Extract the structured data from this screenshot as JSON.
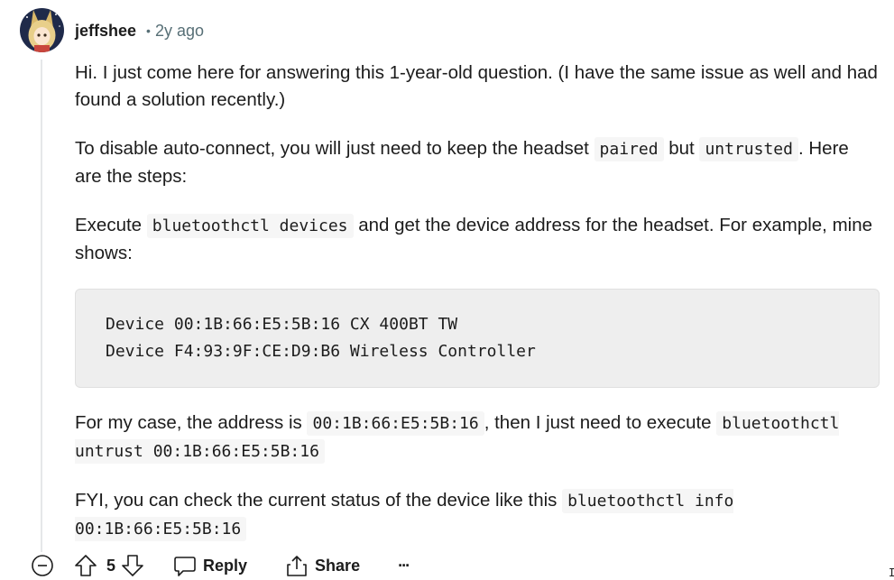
{
  "comment": {
    "author": "jeffshee",
    "separator": "•",
    "age": "2y ago",
    "paragraphs": {
      "p1": "Hi. I just come here for answering this 1-year-old question. (I have the same issue as well and had found a solution recently.)",
      "p2_a": "To disable auto-connect, you will just need to keep the headset ",
      "p2_code1": "paired",
      "p2_b": " but ",
      "p2_code2": "untrusted",
      "p2_c": ". Here are the steps:",
      "p3_a": "Execute ",
      "p3_code": "bluetoothctl devices",
      "p3_b": " and get the device address for the headset. For example, mine shows:",
      "code_block": [
        "Device 00:1B:66:E5:5B:16 CX 400BT TW",
        "Device F4:93:9F:CE:D9:B6 Wireless Controller"
      ],
      "p4_a": "For my case, the address is ",
      "p4_code1": "00:1B:66:E5:5B:16",
      "p4_b": ", then I just need to execute ",
      "p4_code2": "bluetoothctl untrust 00:1B:66:E5:5B:16",
      "p5_a": "FYI, you can check the current status of the device like this ",
      "p5_code": "bluetoothctl info 00:1B:66:E5:5B:16"
    }
  },
  "actions": {
    "collapse_icon": "minus-circle-icon",
    "upvote_icon": "arrow-up-icon",
    "score": "5",
    "downvote_icon": "arrow-down-icon",
    "reply_icon": "speech-bubble-icon",
    "reply_label": "Reply",
    "share_icon": "share-icon",
    "share_label": "Share",
    "more_label": "···"
  },
  "colors": {
    "text": "#1c1c1c",
    "meta": "#576f76",
    "code_bg": "#f6f6f6",
    "block_bg": "#eeeeee",
    "thread_line": "#e5e7e9"
  }
}
